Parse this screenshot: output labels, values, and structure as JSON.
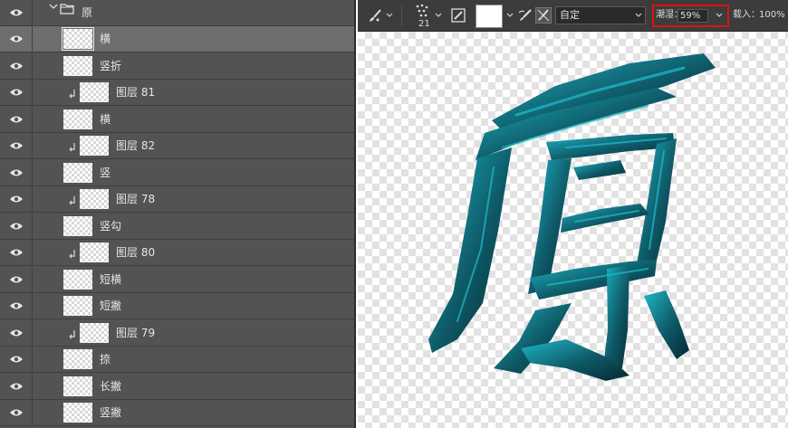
{
  "layers_panel": {
    "group": {
      "name": "原"
    },
    "layers": [
      {
        "name": "横",
        "clipped": false,
        "selected": true
      },
      {
        "name": "竖折",
        "clipped": false,
        "selected": false
      },
      {
        "name": "图层 81",
        "clipped": true,
        "selected": false
      },
      {
        "name": "横",
        "clipped": false,
        "selected": false
      },
      {
        "name": "图层 82",
        "clipped": true,
        "selected": false
      },
      {
        "name": "竖",
        "clipped": false,
        "selected": false
      },
      {
        "name": "图层 78",
        "clipped": true,
        "selected": false
      },
      {
        "name": "竖勾",
        "clipped": false,
        "selected": false
      },
      {
        "name": "图层 80",
        "clipped": true,
        "selected": false
      },
      {
        "name": "短横",
        "clipped": false,
        "selected": false
      },
      {
        "name": "短撇",
        "clipped": false,
        "selected": false
      },
      {
        "name": "图层 79",
        "clipped": true,
        "selected": false
      },
      {
        "name": "捺",
        "clipped": false,
        "selected": false
      },
      {
        "name": "长撇",
        "clipped": false,
        "selected": false
      },
      {
        "name": "竖撇",
        "clipped": false,
        "selected": false
      }
    ]
  },
  "toolbar": {
    "brush_size": "21",
    "preset": "自定",
    "flow_label": "潮湿：",
    "flow_value": "59%",
    "load_label": "载入：",
    "load_value": "100%"
  },
  "canvas": {
    "glyph": "原",
    "stroke_color": "#0e5866",
    "highlight_color": "#1fb8c8",
    "dark_color": "#042a33"
  }
}
